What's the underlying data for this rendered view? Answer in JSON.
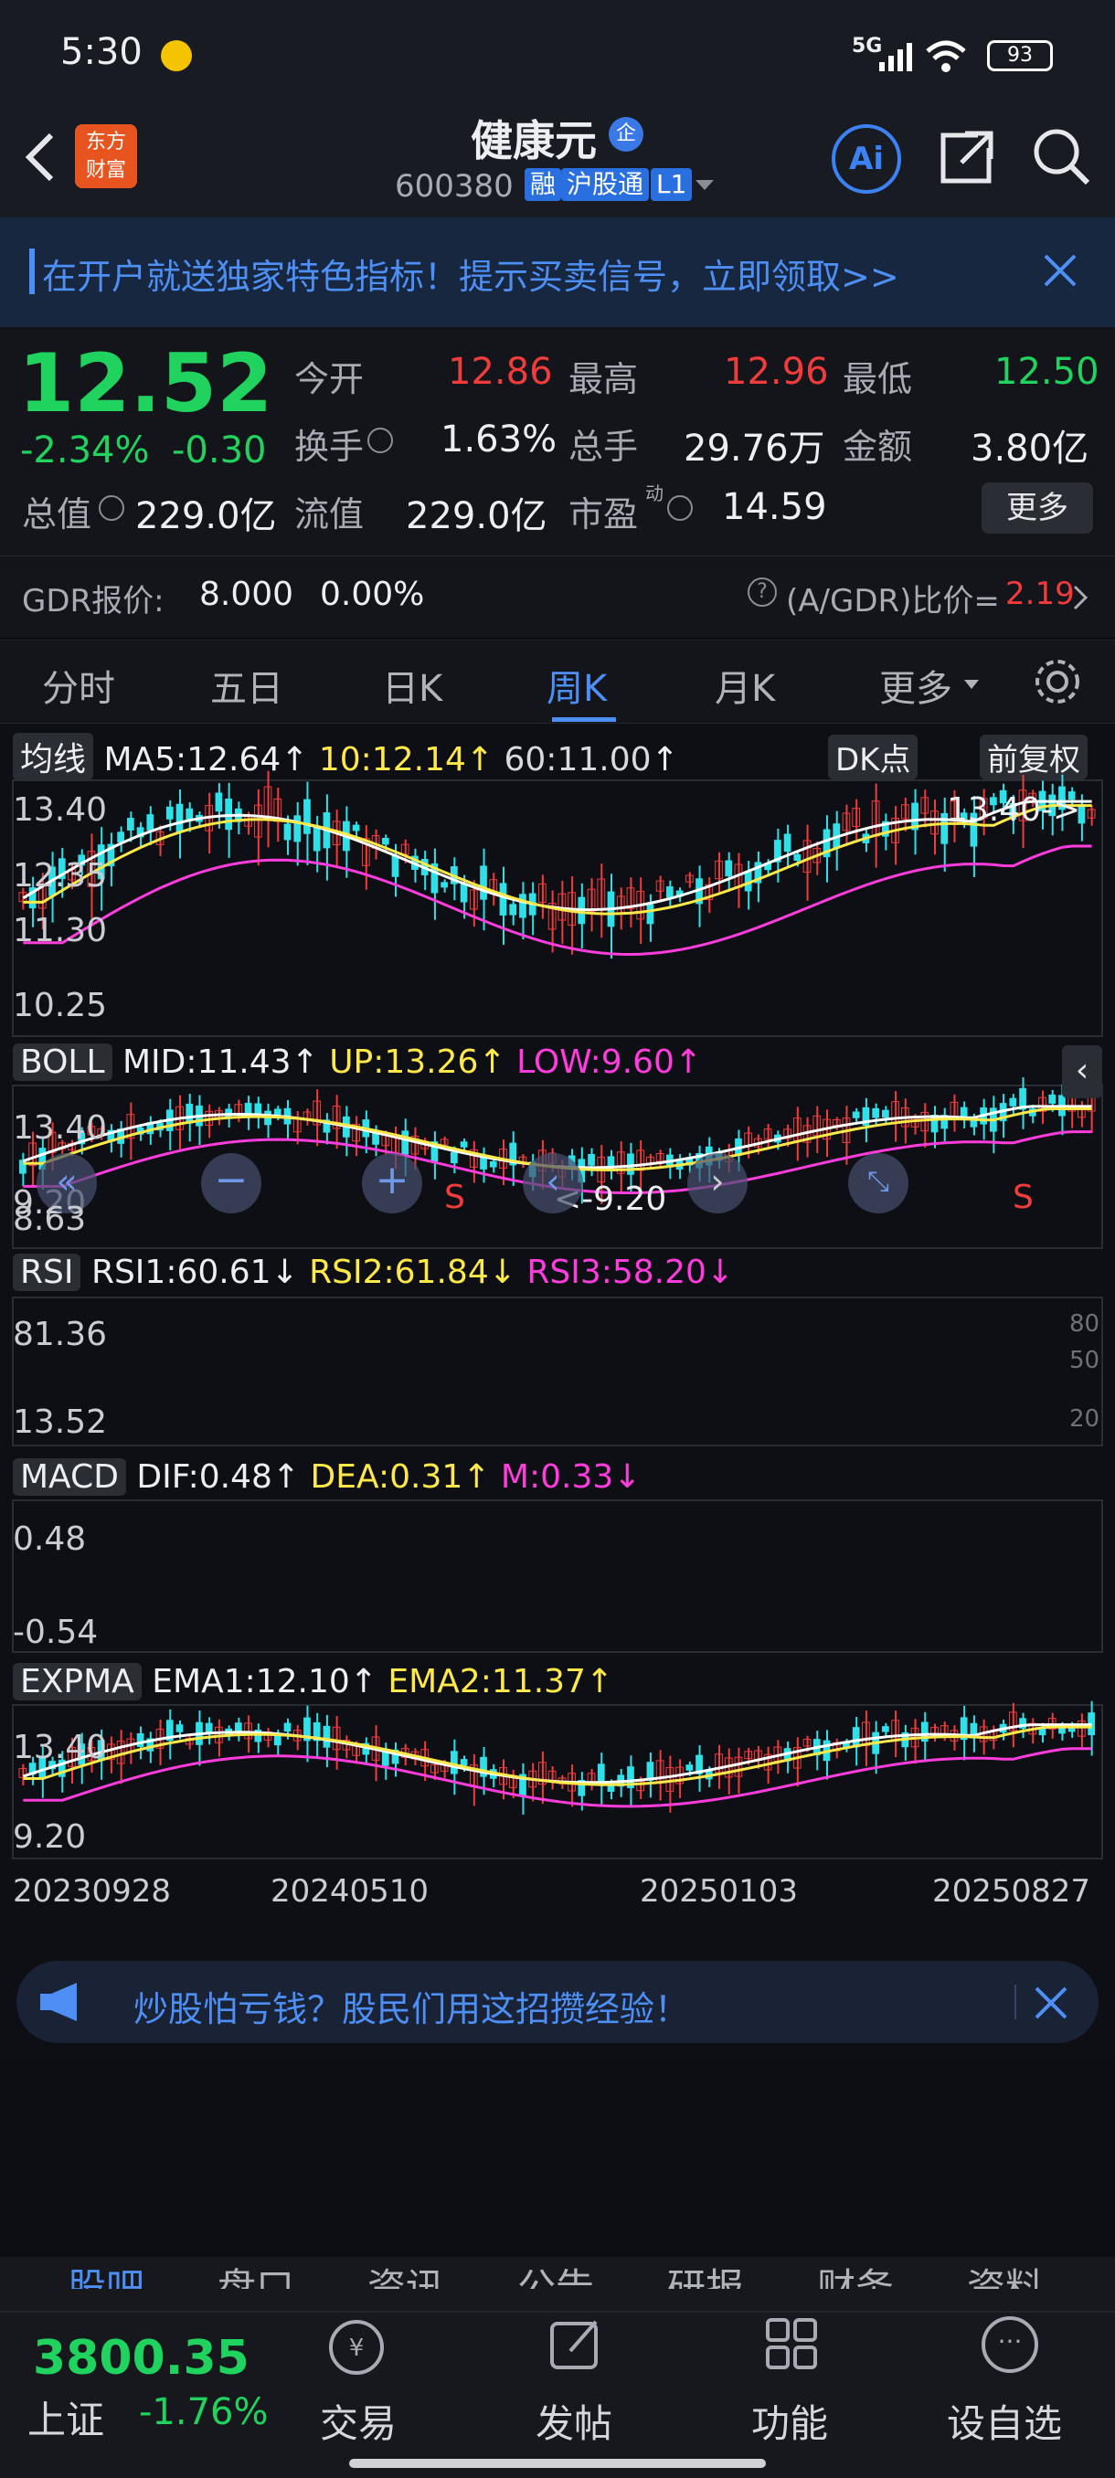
{
  "status": {
    "time": "5:30",
    "network": "5G",
    "battery": "93"
  },
  "header": {
    "logo_line1": "东方",
    "logo_line2": "财富",
    "name": "健康元",
    "name_badge": "企",
    "code": "600380",
    "tags": [
      "融",
      "沪股通",
      "L1"
    ],
    "ai_label": "Ai"
  },
  "banner": {
    "text": "在开户就送独家特色指标！提示买卖信号，立即领取>>"
  },
  "quote": {
    "price": "12.52",
    "change_pct": "-2.34%",
    "change": "-0.30",
    "fields": [
      {
        "label": "今开",
        "value": "12.86",
        "color": "red"
      },
      {
        "label": "最高",
        "value": "12.96",
        "color": "red"
      },
      {
        "label": "最低",
        "value": "12.50",
        "color": "green"
      },
      {
        "label": "换手",
        "value": "1.63%",
        "color": "white"
      },
      {
        "label": "总手",
        "value": "29.76万",
        "color": "white"
      },
      {
        "label": "金额",
        "value": "3.80亿",
        "color": "white"
      },
      {
        "label": "总值",
        "value": "229.0亿",
        "color": "white"
      },
      {
        "label": "流值",
        "value": "229.0亿",
        "color": "white"
      },
      {
        "label": "市盈",
        "value": "14.59",
        "color": "white"
      }
    ],
    "pe_sup": "动",
    "more": "更多",
    "gdr_label": "GDR报价:",
    "gdr_value": "8.000",
    "gdr_pct": "0.00%",
    "gdr_ratio_label": "(A/GDR)比价=",
    "gdr_ratio": "2.19"
  },
  "tabs": [
    "分时",
    "五日",
    "日K",
    "周K",
    "月K",
    "更多"
  ],
  "main": {
    "selector": "均线",
    "ma5": "MA5:12.64",
    "ma10": "10:12.14",
    "ma60": "60:11.00",
    "dk": "DK点",
    "adjust": "前复权",
    "yticks": [
      "13.40",
      "12.35",
      "11.30",
      "10.25",
      "9.20"
    ],
    "max_note": "13.40->",
    "min_note": "<-9.20",
    "signals": [
      "S",
      "S"
    ]
  },
  "boll": {
    "name": "BOLL",
    "mid": "MID:11.43",
    "up": "UP:13.26",
    "low": "LOW:9.60",
    "y_top": "13.40",
    "y_bottom": "8.63"
  },
  "rsi": {
    "name": "RSI",
    "r1": "RSI1:60.61",
    "r2": "RSI2:61.84",
    "r3": "RSI3:58.20",
    "y_top": "81.36",
    "y_bottom": "13.52",
    "levels": [
      "80",
      "50",
      "20"
    ]
  },
  "macd": {
    "name": "MACD",
    "dif": "DIF:0.48",
    "dea": "DEA:0.31",
    "m": "M:0.33",
    "y_top": "0.48",
    "y_bottom": "-0.54"
  },
  "expma": {
    "name": "EXPMA",
    "e1": "EMA1:12.10",
    "e2": "EMA2:11.37",
    "y_top": "13.40",
    "y_bottom": "9.20"
  },
  "dates": [
    "20230928",
    "20240510",
    "20250103",
    "20250827"
  ],
  "ad": {
    "text": "炒股怕亏钱？股民们用这招攒经验！"
  },
  "section_tabs": [
    "股吧",
    "盘口",
    "资讯",
    "公告",
    "研报",
    "财务",
    "资料"
  ],
  "index": {
    "value": "3800.35",
    "name": "上证",
    "pct": "-1.76%"
  },
  "nav": [
    "交易",
    "发帖",
    "功能",
    "设自选"
  ],
  "colors": {
    "up": "#f23c3c",
    "down": "#1fd35e",
    "accent": "#4e8ff5"
  }
}
